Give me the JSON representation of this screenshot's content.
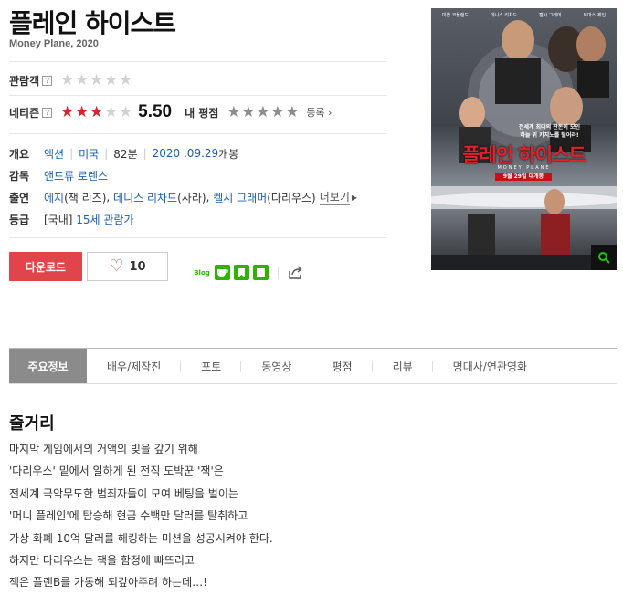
{
  "movie": {
    "title": "플레인 하이스트",
    "subtitle": "Money Plane, 2020"
  },
  "ratings": {
    "audience_label": "관람객",
    "help_mark": "?",
    "netizen_label": "네티즌",
    "netizen_score": "5.50",
    "netizen_fill": 0.55,
    "my_rating_label": "내 평점",
    "register_label": "등록",
    "star_char": "★"
  },
  "info": {
    "overview": {
      "label": "개요",
      "genre": "액션",
      "country": "미국",
      "runtime": "82분",
      "release_date": "2020 .09.29",
      "release_suffix": "개봉"
    },
    "director": {
      "label": "감독",
      "name": "앤드류 로렌스"
    },
    "cast": {
      "label": "출연",
      "actors": [
        {
          "name": "에지",
          "role": "(잭 리즈)"
        },
        {
          "name": "데니스 리차드",
          "role": "(사라)"
        },
        {
          "name": "켈시 그래머",
          "role": "(다리우스)"
        }
      ],
      "more_label": "더보기",
      "more_arrow": "▶"
    },
    "grade": {
      "label": "등급",
      "prefix": "[국내]",
      "value": "15세 관람가"
    }
  },
  "actions": {
    "download_label": "다운로드",
    "like_count": "10",
    "heart_icon": "♡"
  },
  "share": {
    "blog_label": "Blog",
    "icons": [
      "blog-icon",
      "cafe-icon",
      "bookmark-icon",
      "line-icon",
      "share-icon"
    ]
  },
  "poster": {
    "top_names": [
      "미찹 코플랜드",
      "데니스 리차드",
      "켈시 그래머",
      "토마스 제인"
    ],
    "tagline_1": "전세계 최대의 판돈이 모인",
    "tagline_2": "하늘 위 카지노를 털어라!",
    "title": "플레인 하이스트",
    "english_title": "MONEY PLANE",
    "release": "9월 29일 대개봉"
  },
  "tabs": [
    {
      "label": "주요정보",
      "active": true
    },
    {
      "label": "배우/제작진"
    },
    {
      "label": "포토"
    },
    {
      "label": "동영상"
    },
    {
      "label": "평점"
    },
    {
      "label": "리뷰"
    },
    {
      "label": "명대사/연관영화"
    }
  ],
  "plot": {
    "heading": "줄거리",
    "lines": [
      "마지막 게임에서의 거액의 빚을 갚기 위해",
      " '다리우스' 밑에서 일하게 된 전직 도박꾼 '잭'은",
      " 전세계 극악무도한 범죄자들이 모여 베팅을 벌이는",
      " '머니 플레인'에 탑승해 현금 수백만 달러를 탈취하고",
      " 가상 화폐 10억 달러를 해킹하는 미션을 성공시켜야 한다.",
      " 하지만 다리우스는 잭을 함정에 빠뜨리고",
      " 잭은 플랜B를 가동해 되갚아주려 하는데…!"
    ]
  },
  "colors": {
    "accent_red": "#e1454c",
    "star_red": "#d9242f",
    "link_blue": "#1a5fb4",
    "tab_active": "#8b8b8b"
  }
}
